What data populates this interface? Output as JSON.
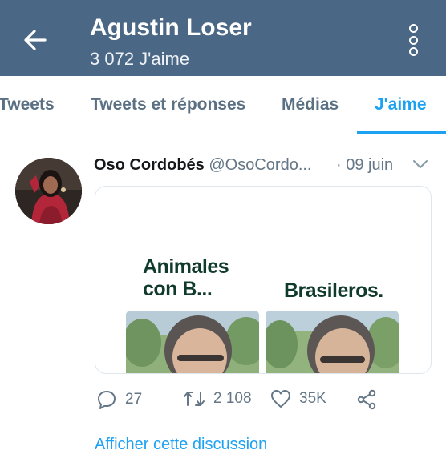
{
  "header": {
    "title": "Agustin Loser",
    "subtitle": "3 072 J'aime",
    "back_icon": "arrow-left-icon",
    "more_icon": "more-vertical-icon",
    "background": "#4a6785"
  },
  "tabs": [
    {
      "label": "Tweets",
      "active": false
    },
    {
      "label": "Tweets et réponses",
      "active": false
    },
    {
      "label": "Médias",
      "active": false
    },
    {
      "label": "J'aime",
      "active": true
    }
  ],
  "tweet": {
    "display_name": "Oso Cordobés",
    "handle": "@OsoCordo...",
    "date": "· 09 juin",
    "media": {
      "label_left": "Animales con B...",
      "label_right": "Brasileros."
    },
    "actions": {
      "reply_count": "27",
      "retweet_count": "2 108",
      "like_count": "35K"
    },
    "show_thread": "Afficher cette discussion"
  },
  "colors": {
    "accent": "#1da1f2",
    "text_secondary": "#657786"
  }
}
